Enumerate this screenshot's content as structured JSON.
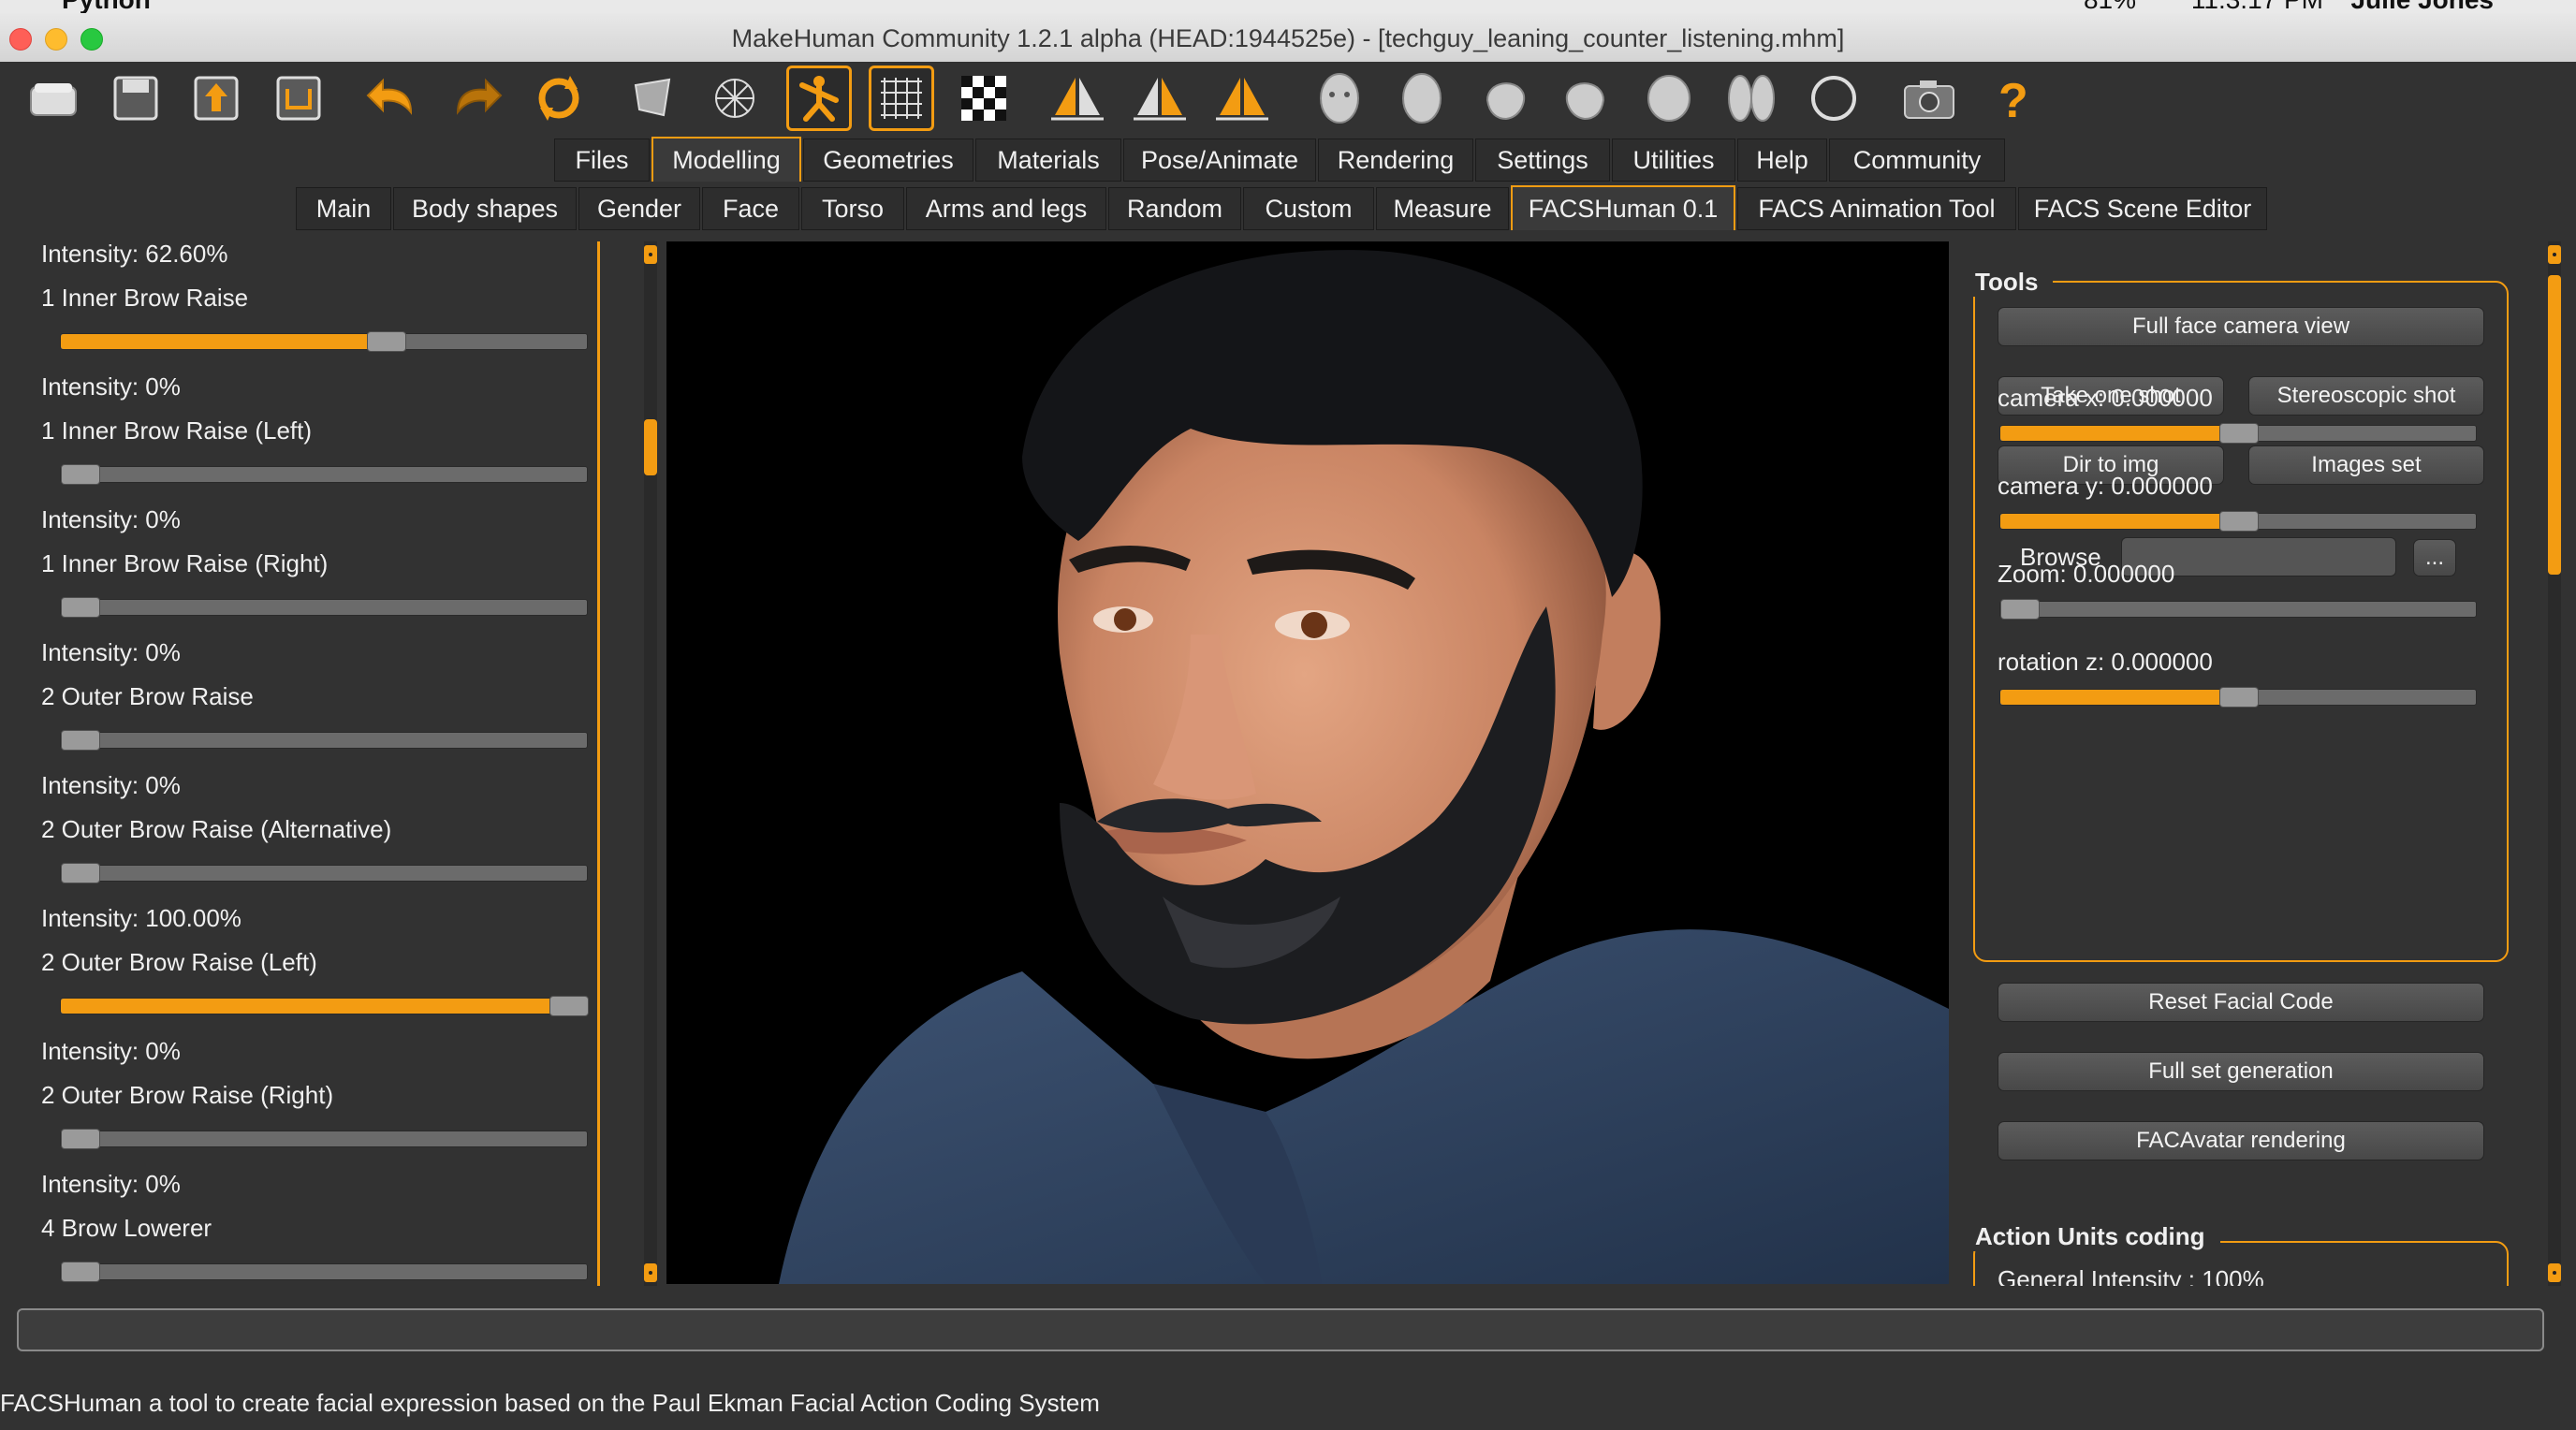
{
  "menubar": {
    "app": "Python",
    "battery": "81%",
    "clock": "11:3:17 PM",
    "user": "Julie Jones"
  },
  "window": {
    "title": "MakeHuman Community 1.2.1 alpha (HEAD:1944525e) - [techguy_leaning_counter_listening.mhm]"
  },
  "toolbar": {
    "icons": [
      "files-icon",
      "save-icon",
      "export-icon",
      "load-icon",
      "undo-icon",
      "redo-icon",
      "reset-icon",
      "smooth-icon",
      "wireframe-icon",
      "pose-icon",
      "grid-icon",
      "background-icon",
      "symmetry-right-icon",
      "symmetry-left-icon",
      "symmetry-both-icon",
      "front-view-icon",
      "back-view-icon",
      "left-view-icon",
      "right-view-icon",
      "top-view-icon",
      "bottom-view-icon",
      "reset-camera-icon",
      "screenshot-icon",
      "help-icon"
    ],
    "active": [
      "pose-icon",
      "grid-icon"
    ],
    "accent": "#f39c12"
  },
  "main_tabs": [
    "Files",
    "Modelling",
    "Geometries",
    "Materials",
    "Pose/Animate",
    "Rendering",
    "Settings",
    "Utilities",
    "Help",
    "Community"
  ],
  "main_tab_selected": "Modelling",
  "sub_tabs": [
    "Main",
    "Body shapes",
    "Gender",
    "Face",
    "Torso",
    "Arms and legs",
    "Random",
    "Custom",
    "Measure",
    "FACSHuman 0.1",
    "FACS Animation Tool",
    "FACS Scene Editor"
  ],
  "sub_tab_selected": "FACSHuman 0.1",
  "left_sliders": [
    {
      "intensity": "Intensity: 62.60%",
      "name": "1 Inner Brow Raise",
      "value": 0.626
    },
    {
      "intensity": "Intensity: 0%",
      "name": "1 Inner Brow Raise (Left)",
      "value": 0
    },
    {
      "intensity": "Intensity: 0%",
      "name": "1 Inner Brow Raise (Right)",
      "value": 0
    },
    {
      "intensity": "Intensity: 0%",
      "name": "2 Outer Brow Raise",
      "value": 0
    },
    {
      "intensity": "Intensity: 0%",
      "name": "2 Outer Brow Raise (Alternative)",
      "value": 0
    },
    {
      "intensity": "Intensity: 100.00%",
      "name": "2 Outer Brow Raise (Left)",
      "value": 1
    },
    {
      "intensity": "Intensity: 0%",
      "name": "2 Outer Brow Raise (Right)",
      "value": 0
    },
    {
      "intensity": "Intensity: 0%",
      "name": "4 Brow Lowerer",
      "value": 0
    }
  ],
  "tools": {
    "title": "Tools",
    "full_face": "Full face camera view",
    "take_one_shot": "Take one shot",
    "stereoscopic_shot": "Stereoscopic shot",
    "dir_to_img": "Dir to img",
    "images_set": "Images set",
    "browse_label": "Browse",
    "browse_value": "",
    "browse_button": "...",
    "sliders": [
      {
        "label": "camera x: 0.000000",
        "value": 0.5
      },
      {
        "label": "camera y: 0.000000",
        "value": 0.5
      },
      {
        "label": "Zoom: 0.000000",
        "value": 0
      },
      {
        "label": "rotation z: 0.000000",
        "value": 0.5
      }
    ],
    "reset_facial_code": "Reset Facial Code",
    "full_set_generation": "Full set generation",
    "facavatar_rendering": "FACAvatar rendering"
  },
  "action_units": {
    "title": "Action Units coding",
    "general_intensity": "General Intensity : 100%"
  },
  "command_line": {
    "value": ""
  },
  "status_bar": "FACSHuman a tool to create facial expression based on the Paul Ekman Facial Action Coding System"
}
